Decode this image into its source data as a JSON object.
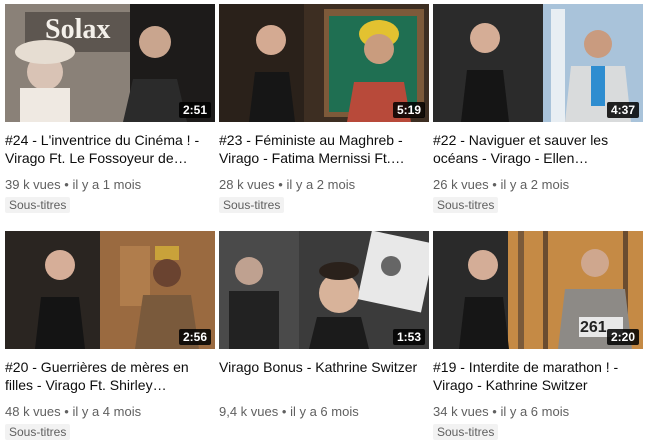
{
  "videos": [
    {
      "title": "#24 - L'inventrice du Cinéma ! - Virago Ft. Le Fossoyeur de…",
      "duration": "2:51",
      "views": "39 k vues",
      "age": "il y a 1 mois",
      "badge": "Sous-titres",
      "thumb_text": "Solax"
    },
    {
      "title": "#23 - Féministe au Maghreb - Virago - Fatima Mernissi Ft.…",
      "duration": "5:19",
      "views": "28 k vues",
      "age": "il y a 2 mois",
      "badge": "Sous-titres"
    },
    {
      "title": "#22 - Naviguer et sauver les océans - Virago - Ellen…",
      "duration": "4:37",
      "views": "26 k vues",
      "age": "il y a 2 mois",
      "badge": "Sous-titres"
    },
    {
      "title": "#20 - Guerrières de mères en filles - Virago Ft. Shirley…",
      "duration": "2:56",
      "views": "48 k vues",
      "age": "il y a 4 mois",
      "badge": "Sous-titres"
    },
    {
      "title": "Virago Bonus - Kathrine Switzer",
      "duration": "1:53",
      "views": "9,4 k vues",
      "age": "il y a 6 mois",
      "badge": ""
    },
    {
      "title": "#19 - Interdite de marathon ! - Virago - Kathrine Switzer",
      "duration": "2:20",
      "views": "34 k vues",
      "age": "il y a 6 mois",
      "badge": "Sous-titres",
      "thumb_text": "261"
    }
  ],
  "meta_separator": "•"
}
